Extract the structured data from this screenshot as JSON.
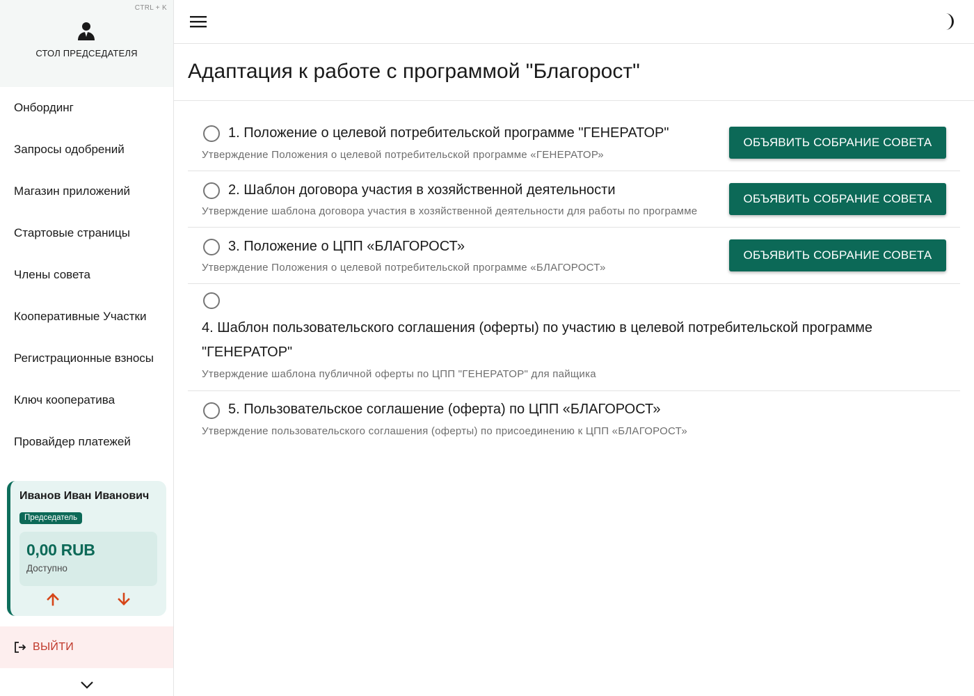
{
  "sidebar": {
    "shortcut": "CTRL + K",
    "desk_title": "СТОЛ ПРЕДСЕДАТЕЛЯ",
    "nav": [
      {
        "label": "Онбординг"
      },
      {
        "label": "Запросы одобрений"
      },
      {
        "label": "Магазин приложений"
      },
      {
        "label": "Стартовые страницы"
      },
      {
        "label": "Члены совета"
      },
      {
        "label": "Кооперативные Участки"
      },
      {
        "label": "Регистрационные взносы"
      },
      {
        "label": "Ключ кооператива"
      },
      {
        "label": "Провайдер платежей"
      }
    ],
    "user": {
      "name": "Иванов Иван Иванович",
      "role": "Председатель",
      "balance": "0,00 RUB",
      "balance_label": "Доступно"
    },
    "logout_label": "ВЫЙТИ"
  },
  "header": {
    "menu_icon": "hamburger-menu-icon",
    "theme_icon": "moon-icon"
  },
  "page": {
    "title": "Адаптация к работе с программой \"Благорост\""
  },
  "items": [
    {
      "title": "1. Положение о целевой потребительской программе \"ГЕНЕРАТОР\"",
      "description": "Утверждение Положения о целевой потребительской программе «ГЕНЕРАТОР»",
      "button": "ОБЪЯВИТЬ СОБРАНИЕ СОВЕТА"
    },
    {
      "title": "2. Шаблон договора участия в хозяйственной деятельности",
      "description": "Утверждение шаблона договора участия в хозяйственной деятельности для работы по программе",
      "button": "ОБЪЯВИТЬ СОБРАНИЕ СОВЕТА"
    },
    {
      "title": "3. Положение о ЦПП «БЛАГОРОСТ»",
      "description": "Утверждение Положения о целевой потребительской программе «БЛАГОРОСТ»",
      "button": "ОБЪЯВИТЬ СОБРАНИЕ СОВЕТА"
    },
    {
      "title": "4. Шаблон пользовательского соглашения (оферты) по участию в целевой потребительской программе \"ГЕНЕРАТОР\"",
      "description": "Утверждение шаблона публичной оферты по ЦПП \"ГЕНЕРАТОР\" для пайщика"
    },
    {
      "title": "5. Пользовательское соглашение (оферта) по ЦПП «БЛАГОРОСТ»",
      "description": "Утверждение пользовательского соглашения (оферты) по присоединению к ЦПП «БЛАГОРОСТ»"
    }
  ],
  "colors": {
    "primary": "#0c6957",
    "logout": "#c0392b",
    "arrow": "#d64518",
    "card_bg": "#e7f4f2"
  }
}
